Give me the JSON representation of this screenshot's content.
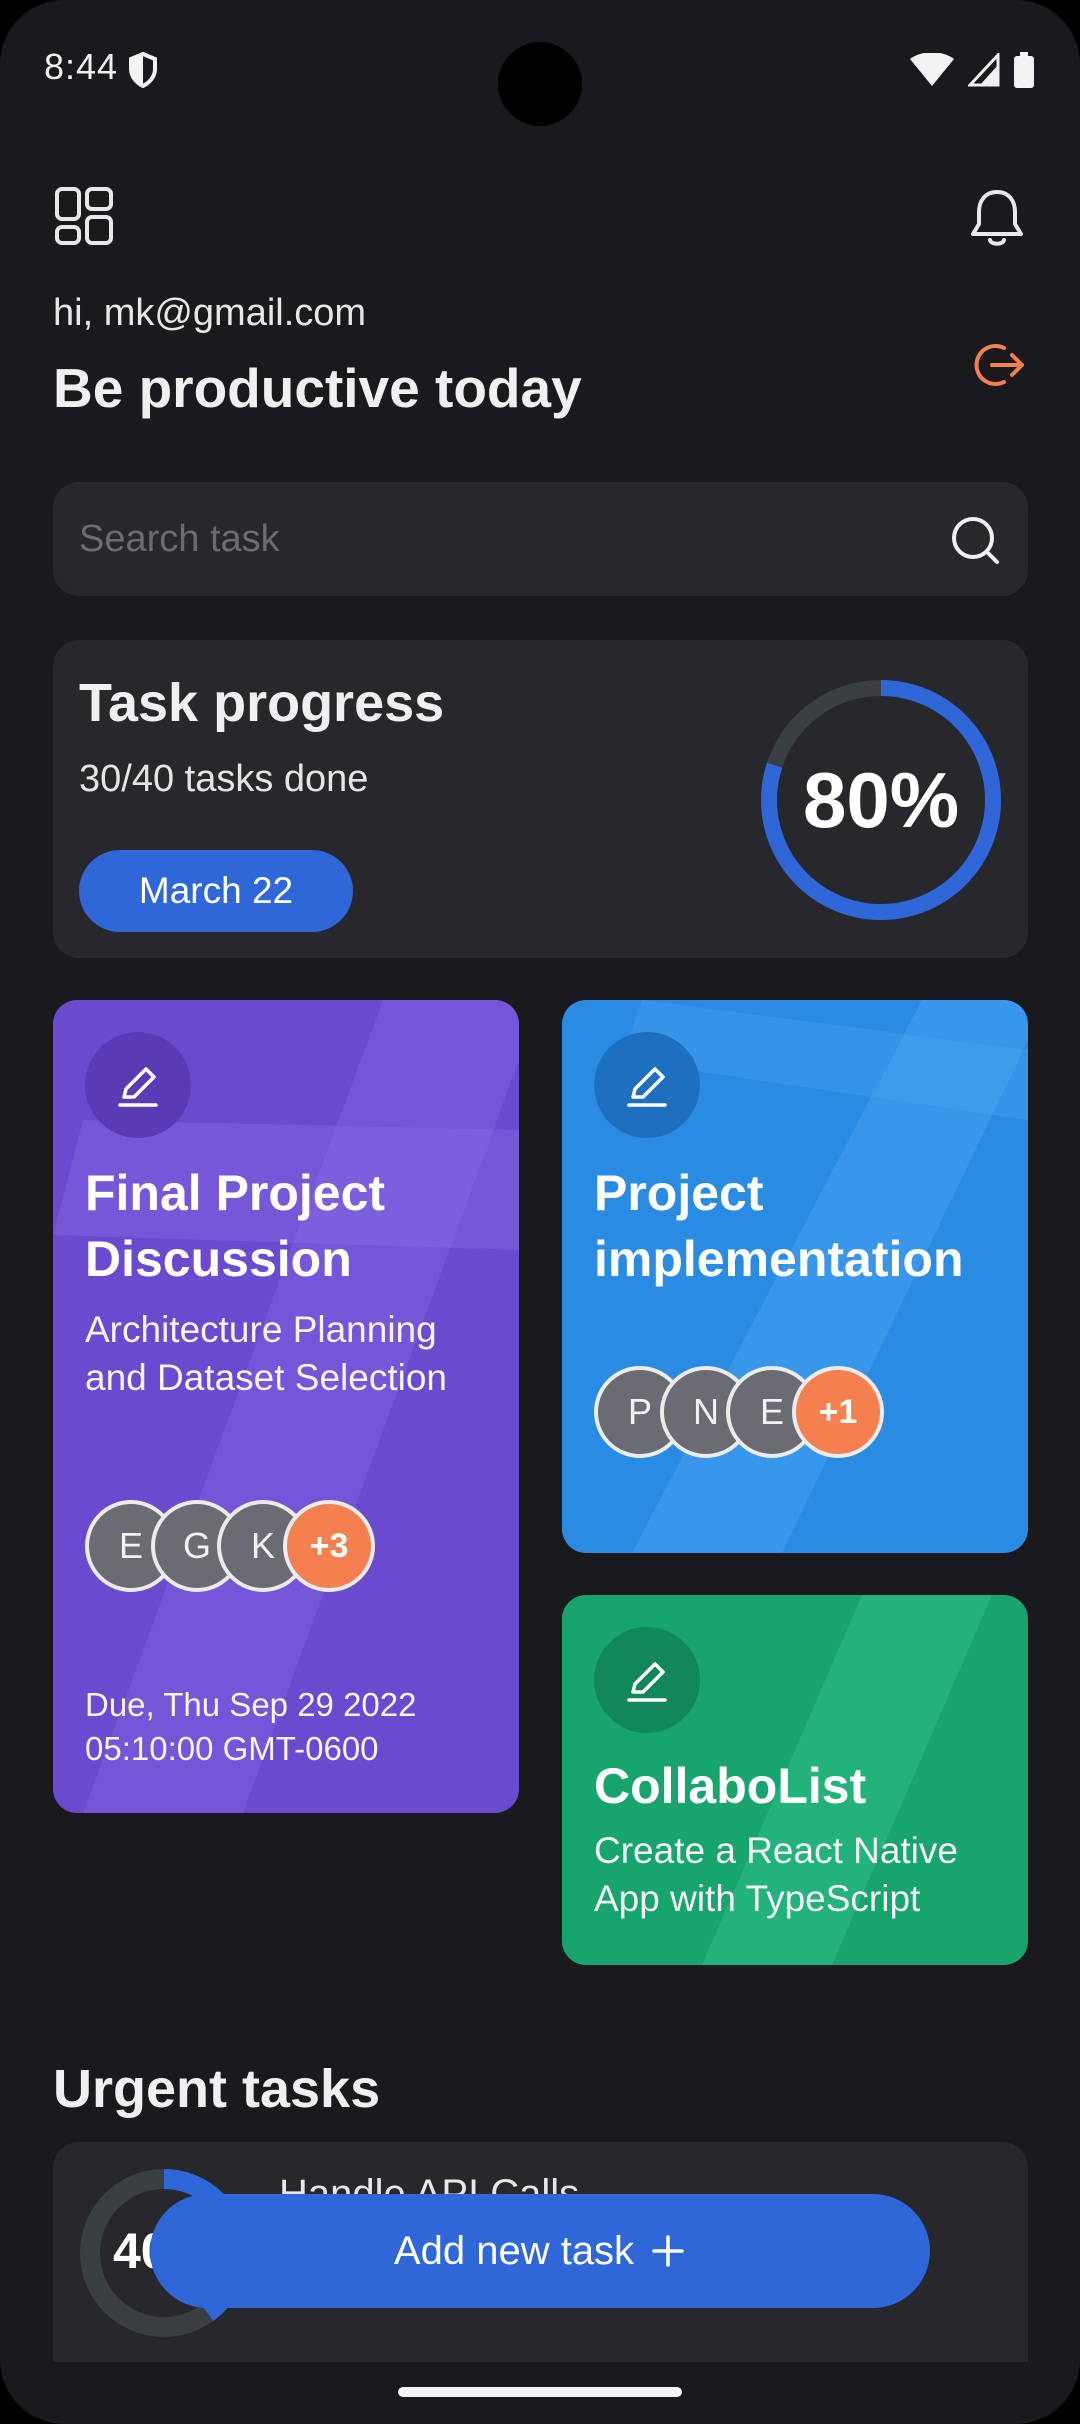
{
  "status_bar": {
    "time": "8:44"
  },
  "header": {
    "greeting": "hi, mk@gmail.com",
    "headline": "Be productive today"
  },
  "search": {
    "placeholder": "Search task"
  },
  "progress": {
    "title": "Task progress",
    "subtitle": "30/40 tasks done",
    "date_label": "March 22",
    "percent_label": "80%",
    "percent_value": 0.8
  },
  "cards": [
    {
      "title_line1": "Final Project",
      "title_line2": "Discussion",
      "desc_line1": "Architecture Planning",
      "desc_line2": "and Dataset Selection",
      "avatars": [
        "E",
        "G",
        "K"
      ],
      "more": "+3",
      "due_line1": "Due, Thu Sep 29 2022",
      "due_line2": "05:10:00 GMT-0600",
      "color": "#6a4acf"
    },
    {
      "title_line1": "Project",
      "title_line2": "implementation",
      "avatars": [
        "P",
        "N",
        "E"
      ],
      "more": "+1",
      "color": "#2a8be3"
    },
    {
      "title_line1": "CollaboList",
      "desc_line1": "Create a React Native",
      "desc_line2": "App with TypeScript",
      "color": "#17a56d"
    }
  ],
  "urgent": {
    "title": "Urgent tasks",
    "item_name": "Handle API Calls",
    "item_percent_label": "40",
    "item_percent_value": 0.4
  },
  "add_button": {
    "label": "Add new task"
  },
  "colors": {
    "background": "#1a1a1e",
    "surface": "#27272c",
    "accent_blue": "#2f66d8",
    "accent_orange": "#f47f4f"
  }
}
